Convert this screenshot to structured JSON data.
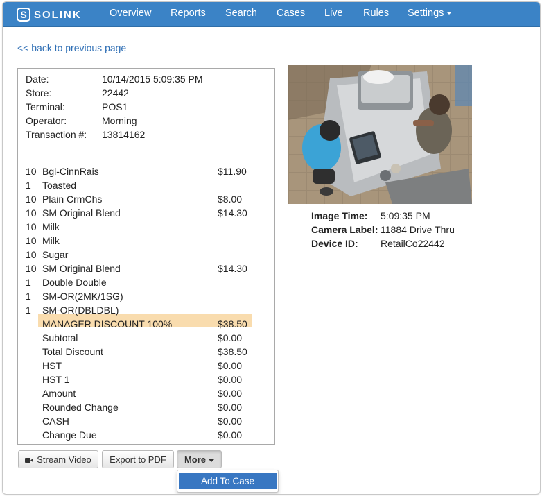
{
  "nav": {
    "logo_text": "SOLINK",
    "items": [
      "Overview",
      "Reports",
      "Search",
      "Cases",
      "Live",
      "Rules"
    ],
    "settings": "Settings"
  },
  "back_link": "<< back to previous page",
  "transaction": {
    "header": [
      {
        "label": "Date:",
        "value": "10/14/2015 5:09:35 PM"
      },
      {
        "label": "Store:",
        "value": "22442"
      },
      {
        "label": "Terminal:",
        "value": "POS1"
      },
      {
        "label": "Operator:",
        "value": "Morning"
      },
      {
        "label": "Transaction #:",
        "value": "13814162"
      }
    ],
    "items": [
      {
        "qty": "10",
        "desc": "Bgl-CinnRais",
        "price": "$11.90"
      },
      {
        "qty": "1",
        "desc": "Toasted",
        "price": ""
      },
      {
        "qty": "10",
        "desc": "Plain CrmChs",
        "price": "$8.00"
      },
      {
        "qty": "10",
        "desc": "SM Original Blend",
        "price": "$14.30"
      },
      {
        "qty": "10",
        "desc": "Milk",
        "price": ""
      },
      {
        "qty": "10",
        "desc": "Milk",
        "price": ""
      },
      {
        "qty": "10",
        "desc": "Sugar",
        "price": ""
      },
      {
        "qty": "10",
        "desc": "SM Original Blend",
        "price": "$14.30"
      },
      {
        "qty": "1",
        "desc": "Double Double",
        "price": ""
      },
      {
        "qty": "1",
        "desc": "SM-OR(2MK/1SG)",
        "price": ""
      },
      {
        "qty": "1",
        "desc": "SM-OR(DBLDBL)",
        "price": ""
      }
    ],
    "highlight": {
      "desc": "MANAGER DISCOUNT 100%",
      "price": "$38.50"
    },
    "totals": [
      {
        "desc": "Subtotal",
        "price": "$0.00"
      },
      {
        "desc": "Total Discount",
        "price": "$38.50"
      },
      {
        "desc": "HST",
        "price": "$0.00"
      },
      {
        "desc": "HST 1",
        "price": "$0.00"
      },
      {
        "desc": "Amount",
        "price": "$0.00"
      },
      {
        "desc": "Rounded Change",
        "price": "$0.00"
      },
      {
        "desc": "CASH",
        "price": "$0.00"
      },
      {
        "desc": "Change Due",
        "price": "$0.00"
      }
    ]
  },
  "buttons": {
    "stream_video": "Stream Video",
    "export_pdf": "Export to PDF",
    "more": "More",
    "add_to_case": "Add To Case"
  },
  "image_info": [
    {
      "label": "Image Time:",
      "value": "5:09:35 PM"
    },
    {
      "label": "Camera Label:",
      "value": "11884 Drive Thru"
    },
    {
      "label": "Device ID:",
      "value": "RetailCo22442"
    }
  ],
  "colors": {
    "navbar": "#3b83c6",
    "link": "#2f6fb5",
    "highlight": "#f9dcae",
    "dropdown_active": "#3877c2"
  },
  "icons": {
    "stream_video": "video-camera-icon",
    "more": "caret-down-icon"
  }
}
